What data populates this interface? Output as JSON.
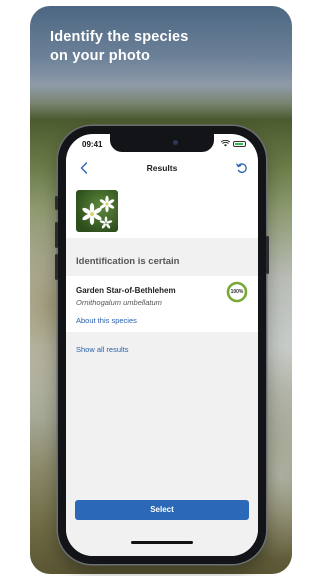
{
  "promo": {
    "headline_line1": "Identify the species",
    "headline_line2": "on your photo"
  },
  "status_bar": {
    "time": "09:41"
  },
  "navbar": {
    "title": "Results",
    "back_icon": "chevron-left-icon",
    "refresh_icon": "refresh-icon"
  },
  "identification": {
    "certainty_text": "Identification is certain"
  },
  "top_result": {
    "common_name": "Garden Star-of-Bethlehem",
    "latin_name": "Ornithogalum umbellatum",
    "about_link": "About this species",
    "score_label": "100%",
    "score_value": 1.0
  },
  "show_all_link": "Show all results",
  "select_button": "Select",
  "colors": {
    "accent": "#2b68b7",
    "score_ring": "#78a832"
  }
}
